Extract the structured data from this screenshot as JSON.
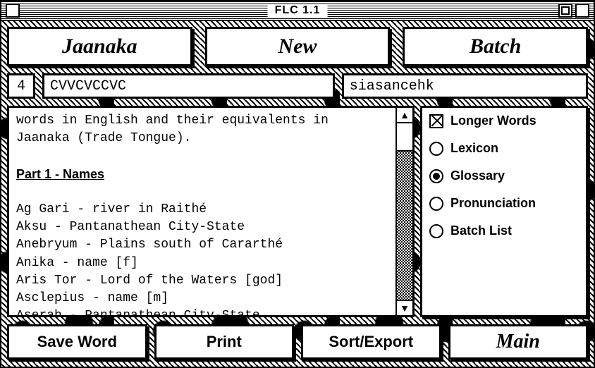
{
  "window": {
    "title": "FLC 1.1"
  },
  "top": {
    "language_label": "Jaanaka",
    "new_label": "New",
    "batch_label": "Batch"
  },
  "pattern": {
    "count": "4",
    "cv_pattern": "CVVCVCCVC",
    "sample": "siasancehk"
  },
  "glossary": {
    "intro_line1": "words in English and their equivalents in",
    "intro_line2": "Jaanaka (Trade Tongue).",
    "heading": "Part 1 - Names",
    "entries": [
      "Ag Gari - river in Raithé",
      "Aksu - Pantanathean City-State",
      "Anebryum - Plains south of Cararthé",
      "Anika - name [f]",
      "Aris Tor - Lord of the Waters [god]",
      "Asclepius - name [m]",
      "Aserah - Pantanathean City-State"
    ]
  },
  "options": {
    "longer_words": {
      "label": "Longer Words",
      "checked": true
    },
    "radios": [
      {
        "label": "Lexicon",
        "selected": false
      },
      {
        "label": "Glossary",
        "selected": true
      },
      {
        "label": "Pronunciation",
        "selected": false
      },
      {
        "label": "Batch List",
        "selected": false
      }
    ]
  },
  "buttons": {
    "save": "Save Word",
    "print": "Print",
    "sort": "Sort/Export",
    "main": "Main"
  }
}
